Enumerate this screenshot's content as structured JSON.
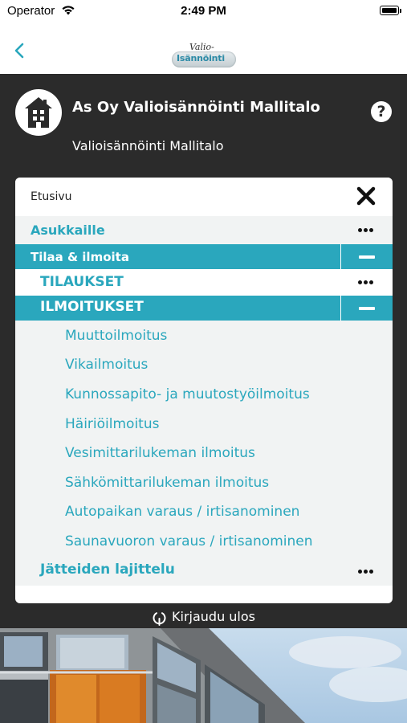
{
  "status_bar": {
    "carrier": "Operator",
    "time": "2:49 PM"
  },
  "nav": {
    "logo_top": "Valio-",
    "logo_bottom": "Isännöinti"
  },
  "header": {
    "title": "As Oy Valioisännöinti Mallitalo",
    "subtitle": "Valioisännöinti Mallitalo",
    "help_label": "?"
  },
  "menu": {
    "home": "Etusivu",
    "asukkaille": "Asukkaille",
    "tilaa": "Tilaa & ilmoita",
    "tilaukset": "TILAUKSET",
    "ilmoitukset": "ILMOITUKSET",
    "ilmoitukset_items": [
      "Muuttoilmoitus",
      "Vikailmoitus",
      "Kunnossapito- ja muutostyöilmoitus",
      "Häiriöilmoitus",
      "Vesimittarilukeman ilmoitus",
      "Sähkömittarilukeman ilmoitus",
      "Autopaikan varaus / irtisanominen",
      "Saunavuoron varaus / irtisanominen"
    ],
    "jatteiden": "Jätteiden lajittelu"
  },
  "logout": {
    "label": "Kirjaudu ulos"
  },
  "colors": {
    "accent": "#2aa7bd",
    "dark": "#2b2b2b",
    "light_grey": "#f1f3f3"
  }
}
